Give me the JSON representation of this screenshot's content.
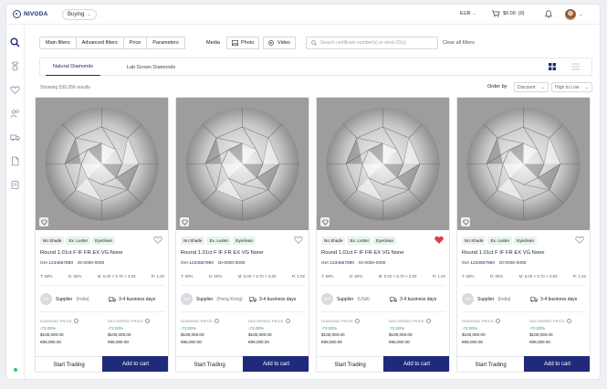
{
  "app": {
    "logo_text": "NIVODA",
    "mode": "Buying"
  },
  "topbar": {
    "currency": "EUR",
    "cart_total": "$0.00",
    "cart_count": "(0)"
  },
  "filters": {
    "buttons": [
      "Main filters",
      "Advanced filters",
      "Price",
      "Parameters"
    ],
    "media_label": "Media",
    "photo_label": "Photo",
    "video_label": "Video",
    "search_placeholder": "Search certificate number(s) or stock ID(s)",
    "clear_all": "Clear all filters"
  },
  "tabs": [
    "Natural Diamonds",
    "Lab Grown Diamonds"
  ],
  "results": {
    "text": "Showing 539,356 results",
    "order_by": "Order by",
    "sort_field": "Discount",
    "sort_direction": "High to Low"
  },
  "icons": {
    "sidebar": [
      "search-icon",
      "diamond-ring-icon",
      "heart-icon",
      "users-icon",
      "truck-icon",
      "document-icon",
      "invoice-icon"
    ],
    "accent": "#1f2a7b",
    "favorite_active": "#e23b4e"
  },
  "cards": [
    {
      "chips": [
        "No Shade",
        "Ex. Luster",
        "Eyeclean"
      ],
      "title": "Round 1.01ct F IF FR EX VG None",
      "cert": "GIA 1234567890",
      "stock_id": "ID-0000-0000",
      "specs": [
        "T: 58%",
        "D: 60%",
        "M: 5.00 × 5.70 × 3.83",
        "R: 1.02"
      ],
      "supplier_initials": "HK",
      "supplier": "Supplier",
      "supplier_location": "(India)",
      "delivery": "3-4 business days",
      "diamond_price_label": "DIAMOND PRICE",
      "delivered_price_label": "DELIVERED PRICE",
      "diamond_pct": "-72.00%",
      "diamond_usd": "$100,000.00",
      "diamond_eur": "€98,000.00",
      "delivered_pct": "-72.00%",
      "delivered_usd": "$100,000.00",
      "delivered_eur": "€98,000.00",
      "favorite": false,
      "trade_label": "Start Trading",
      "cart_label": "Add to cart"
    },
    {
      "chips": [
        "No Shade",
        "Ex. Luster",
        "Eyeclean"
      ],
      "title": "Round 1.01ct F IF FR EX VG None",
      "cert": "GIA 1234567890",
      "stock_id": "ID-0000-0000",
      "specs": [
        "T: 58%",
        "D: 60%",
        "M: 5.00 × 5.70 × 3.83",
        "R: 1.02"
      ],
      "supplier_initials": "RS",
      "supplier": "Supplier",
      "supplier_location": "(Hong Kong)",
      "delivery": "3-4 business days",
      "diamond_price_label": "DIAMOND PRICE",
      "delivered_price_label": "DELIVERED PRICE",
      "diamond_pct": "-72.00%",
      "diamond_usd": "$100,000.00",
      "diamond_eur": "€98,000.00",
      "delivered_pct": "-72.00%",
      "delivered_usd": "$100,000.00",
      "delivered_eur": "€98,000.00",
      "favorite": false,
      "trade_label": "Start Trading",
      "cart_label": "Add to cart"
    },
    {
      "chips": [
        "No Shade",
        "Ex. Luster",
        "Eyeclean"
      ],
      "title": "Round 1.01ct F IF FR EX VG None",
      "cert": "GIA 1234567890",
      "stock_id": "ID-0000-0000",
      "specs": [
        "T: 58%",
        "D: 60%",
        "M: 5.00 × 5.70 × 3.83",
        "R: 1.02"
      ],
      "supplier_initials": "RH",
      "supplier": "Supplier",
      "supplier_location": "(USA)",
      "delivery": "3-4 business days",
      "diamond_price_label": "DIAMOND PRICE",
      "delivered_price_label": "DELIVERED PRICE",
      "diamond_pct": "-72.00%",
      "diamond_usd": "$100,000.00",
      "diamond_eur": "€98,000.00",
      "delivered_pct": "-72.00%",
      "delivered_usd": "$100,000.00",
      "delivered_eur": "€98,000.00",
      "favorite": true,
      "trade_label": "Start Trading",
      "cart_label": "Add to cart"
    },
    {
      "chips": [
        "No Shade",
        "Ex. Luster",
        "Eyeclean"
      ],
      "title": "Round 1.01ct F IF FR EX VG None",
      "cert": "GIA 1234567890",
      "stock_id": "ID-0000-0000",
      "specs": [
        "T: 58%",
        "D: 60%",
        "M: 5.00 × 5.70 × 3.83",
        "R: 1.02"
      ],
      "supplier_initials": "HK",
      "supplier": "Supplier",
      "supplier_location": "(India)",
      "delivery": "3-4 business days",
      "diamond_price_label": "DIAMOND PRICE",
      "delivered_price_label": "DELIVERED PRICE",
      "diamond_pct": "-72.00%",
      "diamond_usd": "$100,000.00",
      "diamond_eur": "€98,000.00",
      "delivered_pct": "-72.00%",
      "delivered_usd": "$100,000.00",
      "delivered_eur": "€98,000.00",
      "favorite": false,
      "trade_label": "Start Trading",
      "cart_label": "Add to cart"
    }
  ]
}
